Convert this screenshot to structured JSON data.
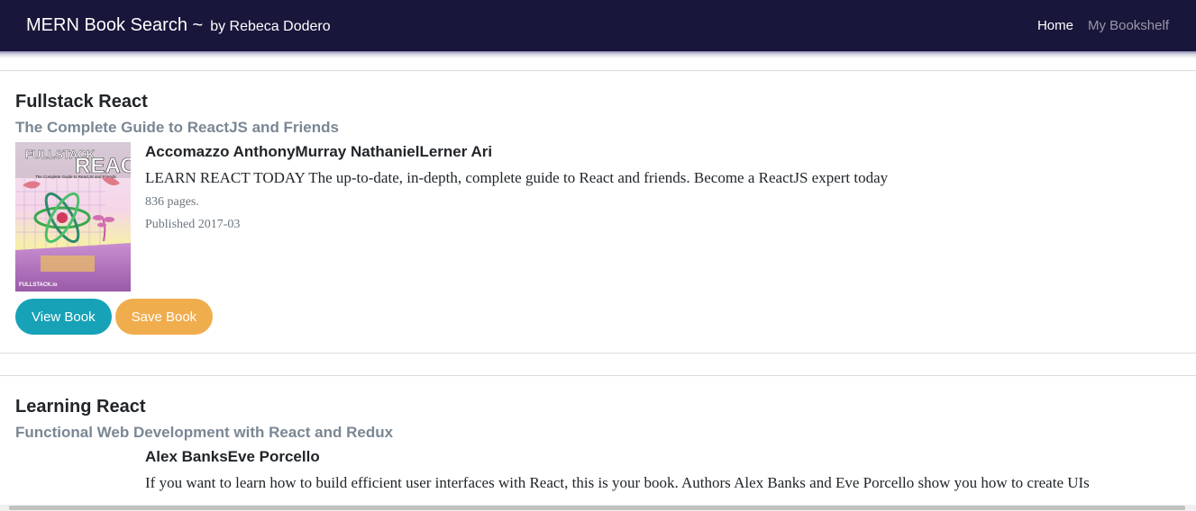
{
  "navbar": {
    "brand": "MERN Book Search ~",
    "brand_by": "by Rebeca Dodero",
    "links": [
      {
        "label": "Home"
      },
      {
        "label": "My Bookshelf"
      }
    ]
  },
  "books": [
    {
      "title": "Fullstack React",
      "subtitle": "The Complete Guide to ReactJS and Friends",
      "authors": "Accomazzo AnthonyMurray NathanielLerner Ari",
      "description": "LEARN REACT TODAY The up-to-date, in-depth, complete guide to React and friends. Become a ReactJS expert today",
      "pages": "836 pages.",
      "published": "Published 2017-03",
      "cover": {
        "title_line1": "FULLSTACK",
        "title_line2": "REACT",
        "subtitle": "The Complete Guide to ReactJS and Friends",
        "publisher": "FULLSTACK.io"
      },
      "view_label": "View Book",
      "save_label": "Save Book"
    },
    {
      "title": "Learning React",
      "subtitle": "Functional Web Development with React and Redux",
      "authors": "Alex BanksEve Porcello",
      "description": "If you want to learn how to build efficient user interfaces with React, this is your book. Authors Alex Banks and Eve Porcello show you how to create UIs"
    }
  ],
  "colors": {
    "navbar": "#18163a",
    "view_button": "#17a2b8",
    "save_button": "#f0ad4e",
    "subtitle": "#7a8794"
  }
}
